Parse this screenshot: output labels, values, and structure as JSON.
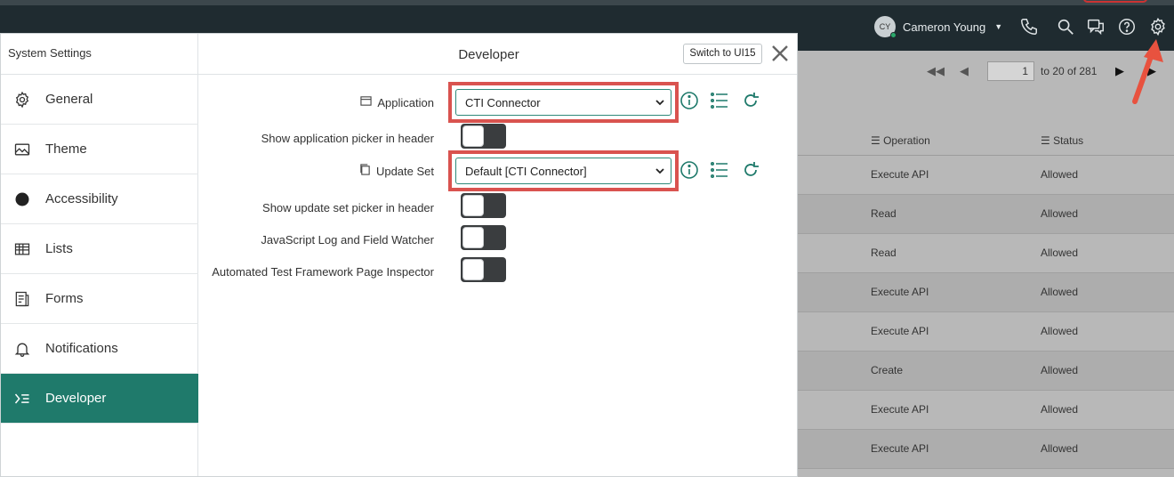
{
  "header": {
    "user_initials": "CY",
    "user_name": "Cameron Young",
    "icons": [
      "phone-icon",
      "search-icon",
      "chat-icon",
      "help-icon",
      "gear-icon"
    ]
  },
  "background_list": {
    "page_number": "1",
    "page_count_text": "to 20 of 281",
    "columns": [
      "Operation",
      "Status"
    ],
    "rows": [
      {
        "operation": "Execute API",
        "status": "Allowed"
      },
      {
        "operation": "Read",
        "status": "Allowed"
      },
      {
        "operation": "Read",
        "status": "Allowed"
      },
      {
        "operation": "Execute API",
        "status": "Allowed"
      },
      {
        "operation": "Execute API",
        "status": "Allowed"
      },
      {
        "operation": "Create",
        "status": "Allowed"
      },
      {
        "operation": "Execute API",
        "status": "Allowed"
      },
      {
        "operation": "Execute API",
        "status": "Allowed"
      }
    ]
  },
  "modal": {
    "sidebar_title": "System Settings",
    "nav": [
      {
        "label": "General",
        "icon": "gear-icon",
        "active": false
      },
      {
        "label": "Theme",
        "icon": "image-icon",
        "active": false
      },
      {
        "label": "Accessibility",
        "icon": "circle-icon",
        "active": false
      },
      {
        "label": "Lists",
        "icon": "table-icon",
        "active": false
      },
      {
        "label": "Forms",
        "icon": "form-icon",
        "active": false
      },
      {
        "label": "Notifications",
        "icon": "bell-icon",
        "active": false
      },
      {
        "label": "Developer",
        "icon": "developer-icon",
        "active": true
      }
    ],
    "title": "Developer",
    "switch_label": "Switch to UI15",
    "fields": {
      "application_label": "Application",
      "application_value": "CTI Connector",
      "app_picker_label": "Show application picker in header",
      "update_set_label": "Update Set",
      "update_set_value": "Default [CTI Connector]",
      "update_set_picker_label": "Show update set picker in header",
      "js_log_label": "JavaScript Log and Field Watcher",
      "atf_label": "Automated Test Framework Page Inspector"
    },
    "toggles": {
      "app_picker": false,
      "update_set_picker": false,
      "js_log": false,
      "atf": false
    }
  },
  "colors": {
    "accent": "#1f7a6b",
    "highlight_box": "#d9534f",
    "header_bg": "#1f2b30"
  }
}
